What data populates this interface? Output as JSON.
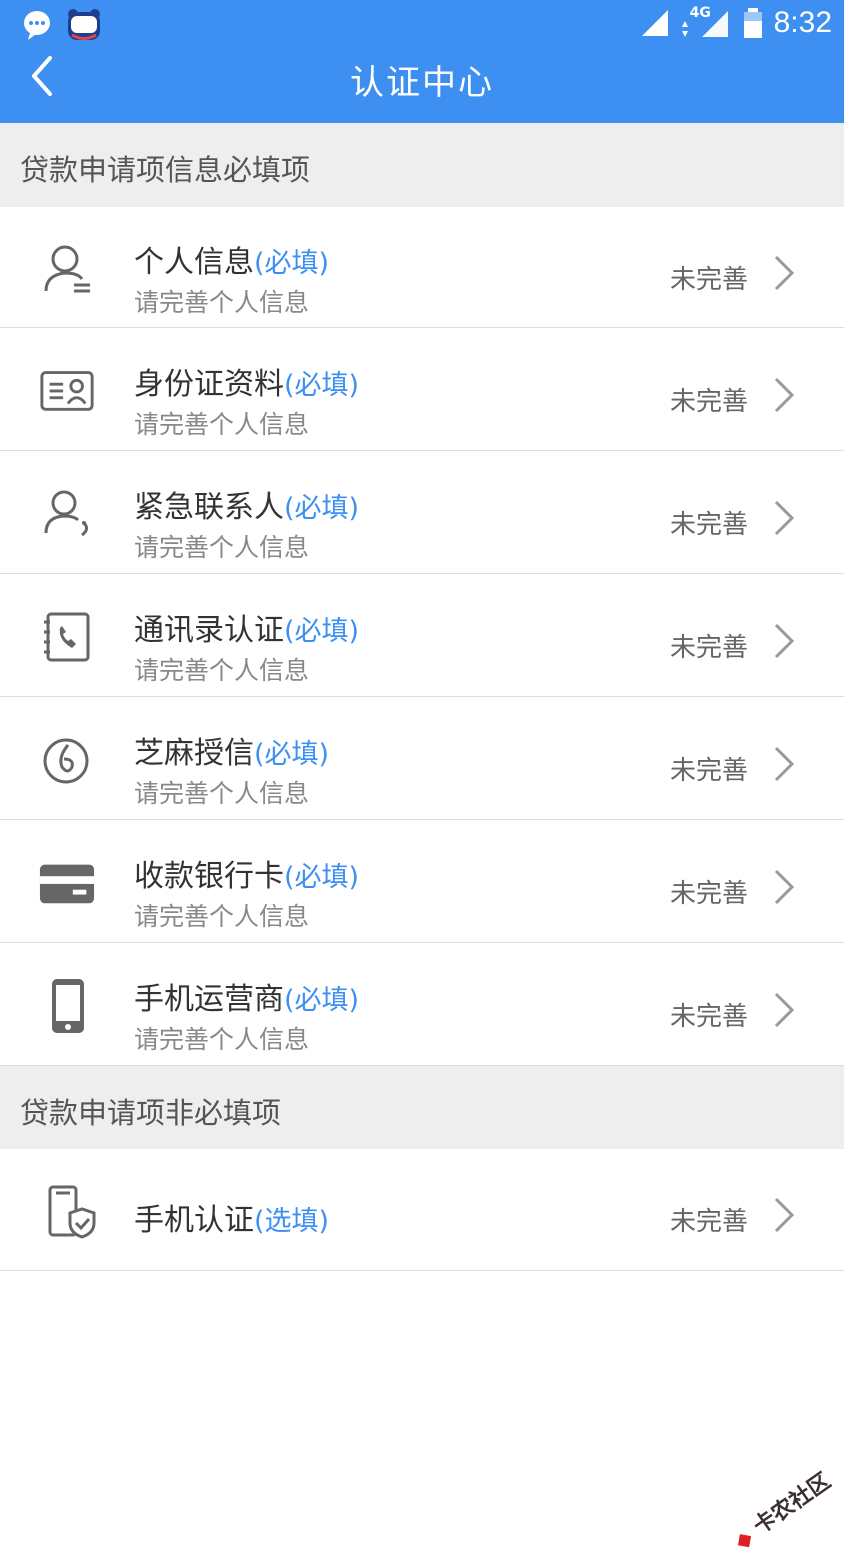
{
  "status_bar": {
    "network": "4G",
    "time": "8:32"
  },
  "header": {
    "title": "认证中心"
  },
  "sections": {
    "required_title": "贷款申请项信息必填项",
    "optional_title": "贷款申请项非必填项"
  },
  "items": [
    {
      "title": "个人信息",
      "tag": "(必填)",
      "subtitle": "请完善个人信息",
      "status": "未完善",
      "icon": "person-icon"
    },
    {
      "title": "身份证资料",
      "tag": "(必填)",
      "subtitle": "请完善个人信息",
      "status": "未完善",
      "icon": "id-card-icon"
    },
    {
      "title": "紧急联系人",
      "tag": "(必填)",
      "subtitle": "请完善个人信息",
      "status": "未完善",
      "icon": "contact-icon"
    },
    {
      "title": "通讯录认证",
      "tag": "(必填)",
      "subtitle": "请完善个人信息",
      "status": "未完善",
      "icon": "phonebook-icon"
    },
    {
      "title": "芝麻授信",
      "tag": "(必填)",
      "subtitle": "请完善个人信息",
      "status": "未完善",
      "icon": "sesame-icon"
    },
    {
      "title": "收款银行卡",
      "tag": "(必填)",
      "subtitle": "请完善个人信息",
      "status": "未完善",
      "icon": "bank-card-icon"
    },
    {
      "title": "手机运营商",
      "tag": "(必填)",
      "subtitle": "请完善个人信息",
      "status": "未完善",
      "icon": "mobile-icon"
    }
  ],
  "optional_items": [
    {
      "title": "手机认证",
      "tag": "(选填)",
      "status": "未完善",
      "icon": "phone-verify-icon"
    }
  ],
  "watermark": "卡农社区",
  "colors": {
    "primary": "#3d8ff2",
    "section_bg": "#eeeeee"
  }
}
